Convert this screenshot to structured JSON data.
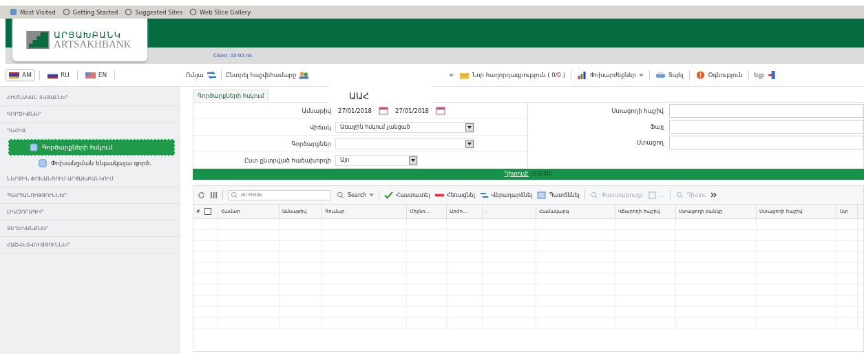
{
  "favorites_bar": {
    "items": [
      {
        "label": "Most Visited"
      },
      {
        "label": "Getting Started"
      },
      {
        "label": "Suggested Sites"
      },
      {
        "label": "Web Slice Gallery"
      }
    ]
  },
  "header": {
    "logo_armenian": "ԱՐՑԱԽԲԱՆԿ",
    "logo_latin": "ARTSAKHBANK",
    "client": "Client: 10:02:44"
  },
  "languages": [
    {
      "label": "AM",
      "selected": true
    },
    {
      "label": "RU",
      "selected": false
    },
    {
      "label": "EN",
      "selected": false
    }
  ],
  "menu": [
    {
      "label": "Ունյա"
    },
    {
      "label": "Ընտրել հաշվեհամարը"
    }
  ],
  "menu_right": {
    "messages_label": "Նոր հաղորդագրություն ( 0/",
    "messages_unread": "0",
    "messages_close": ")",
    "items": [
      {
        "label": "Փոխարժեքներ",
        "dropdown": true
      },
      {
        "label": "Տպել",
        "dropdown": false
      },
      {
        "label": "Օգնություն",
        "dropdown": false
      },
      {
        "label": "Ելք",
        "dropdown": false
      }
    ]
  },
  "sidebar": {
    "items": [
      {
        "label": "ՀԻՄՆԱԿԱՆ ՏՎՅԱԼՆԵՐ",
        "selected": false
      },
      {
        "label": "ԳՈՐԾԻՔՆԵՐ",
        "selected": false
      },
      {
        "label": "ԴԱՀԻՃ",
        "selected": false,
        "children": [
          {
            "label": "Գործարքների հսկում",
            "selected": true
          },
          {
            "label": "Փոխանցման ենթակայա գործ.",
            "selected": false
          }
        ]
      },
      {
        "label": "ՆԵՐՔԻՆ ՓՈԽԱՆՑՈՒՄ ԱՐՑԱԽԲԱՆԿՈՒՄ",
        "selected": false
      },
      {
        "label": "ՊԱՀՊԱՆՈՒԹՅՈՒՆՆԵՐ",
        "selected": false
      },
      {
        "label": "ԼԻԱԶՈՐԱԳԻՐ",
        "selected": false
      },
      {
        "label": "ՏԵՂԵԿԱՆՔՆԵՐ",
        "selected": false
      },
      {
        "label": "ՀԱՇՎԵՏՎՈՒԹՅՈՒՆՆԵՐ",
        "selected": false
      }
    ]
  },
  "panel": {
    "tab": "Գործարքների հսկում",
    "overlay_text": "ԱԱՀ",
    "left_fields": [
      {
        "label": "Ամսաթիվ",
        "kind": "daterange",
        "from": "27/01/2018",
        "to": "27/01/2018"
      },
      {
        "label": "Վիճակ",
        "kind": "select",
        "value": "Առաջին հսկում չանցած"
      },
      {
        "label": "Գործարքներ",
        "kind": "select"
      },
      {
        "label": "Ըստ ընտրված հաճախորդի",
        "kind": "smallselect",
        "value": "Այո"
      }
    ],
    "right_fields": [
      {
        "label": "Ստացողի հաշիվ"
      },
      {
        "label": "Ֆայլ"
      },
      {
        "label": "Ստացող"
      }
    ],
    "show_bar": {
      "label": "Դիտում:",
      "count": "(0-0/40)"
    }
  },
  "toolbar": {
    "search_placeholder": "All Fields",
    "search_button": "Search",
    "actions": [
      {
        "label": "Հաստատել",
        "disabled": false
      },
      {
        "label": "Հեռացնել",
        "disabled": false
      },
      {
        "label": "Վերադարձնել",
        "disabled": false
      },
      {
        "label": "Պատճենել",
        "disabled": false
      },
      {
        "label": "Փաստաթուղթ",
        "disabled": true
      },
      {
        "label": "...",
        "disabled": true
      },
      {
        "label": "Դիտու",
        "disabled": true
      }
    ]
  },
  "table": {
    "select_all_checked": false,
    "columns": [
      "#",
      "Համար",
      "Ամսաթիվ",
      "Գումար",
      "Միջնո...",
      "Արժո...",
      ".",
      "Համակարգ",
      "Վճարողի հաշիվ",
      "Ստացողի բանկը",
      "Ստացողի հաշիվ",
      "Ստ"
    ]
  }
}
